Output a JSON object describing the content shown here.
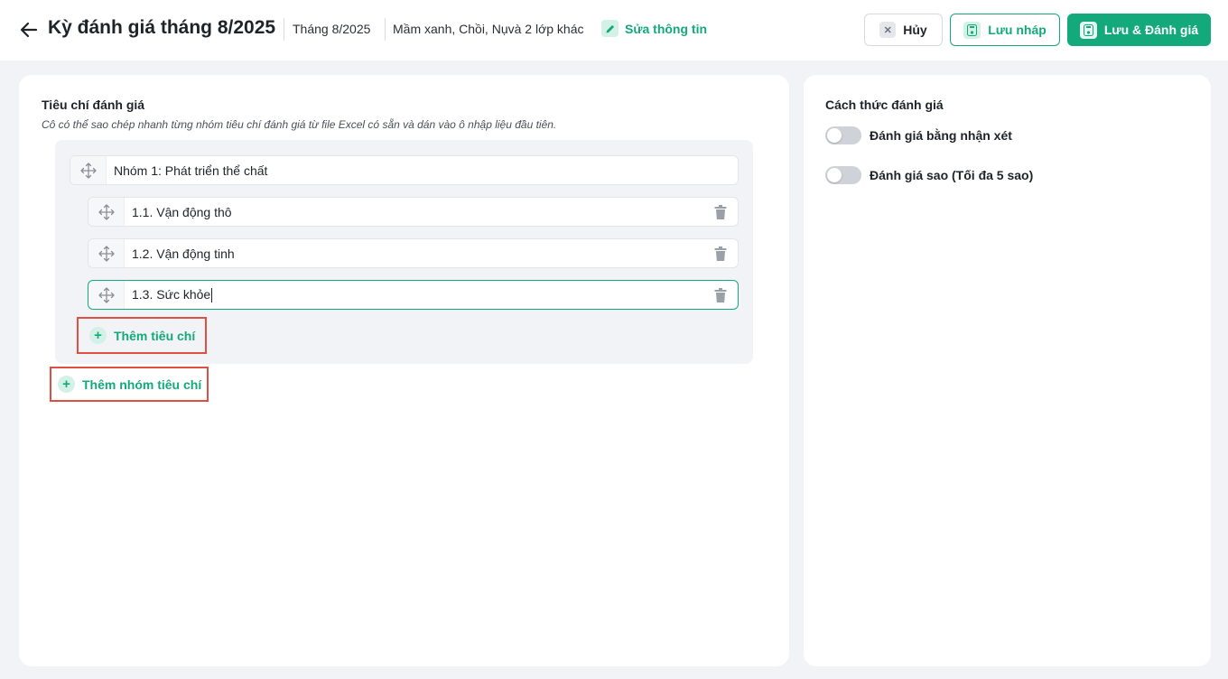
{
  "header": {
    "title": "Kỳ đánh giá tháng 8/2025",
    "period": "Tháng 8/2025",
    "classes": "Mầm xanh, Chồi, Nụvà 2 lớp khác",
    "edit_label": "Sửa thông tin",
    "cancel_label": "Hủy",
    "draft_label": "Lưu nháp",
    "save_label": "Lưu & Đánh giá"
  },
  "criteria": {
    "title": "Tiêu chí đánh giá",
    "hint": "Cô có thể sao chép nhanh từng nhóm tiêu chí đánh giá từ file Excel có sẵn và dán vào ô nhập liệu đầu tiên.",
    "group_name": "Nhóm 1: Phát triển thể chất",
    "items": [
      {
        "label": "1.1. Vận động thô"
      },
      {
        "label": "1.2. Vận động tinh"
      },
      {
        "label": "1.3. Sức khỏe"
      }
    ],
    "add_item_label": "Thêm tiêu chí",
    "add_group_label": "Thêm nhóm tiêu chí"
  },
  "method": {
    "title": "Cách thức đánh giá",
    "options": [
      {
        "label": "Đánh giá bằng nhận xét",
        "enabled": false
      },
      {
        "label": "Đánh giá sao (Tối đa 5 sao)",
        "enabled": false
      }
    ]
  },
  "colors": {
    "accent": "#13a97b",
    "accent_light": "#d3f1e6",
    "highlight_border": "#e04f44",
    "page_bg": "#f2f3f7"
  },
  "icons": [
    "back-arrow-icon",
    "pencil-icon",
    "close-icon",
    "save-disk-icon",
    "drag-move-icon",
    "trash-icon",
    "plus-icon"
  ]
}
